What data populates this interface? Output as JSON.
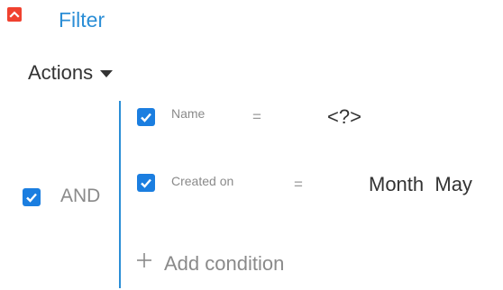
{
  "filter": {
    "title": "Filter",
    "collapse_icon": "chevron-up-icon",
    "accent_color": "#2b8ed6",
    "toggle_color": "#f0412f"
  },
  "actions": {
    "label": "Actions",
    "icon": "caret-down-icon"
  },
  "group": {
    "operator": "AND",
    "checked": true
  },
  "conditions": [
    {
      "field": "Name",
      "operator": "=",
      "value": "<?>",
      "checked": true
    },
    {
      "field": "Created on",
      "operator": "=",
      "value": "Month  May",
      "checked": true
    }
  ],
  "add_condition": {
    "label": "Add condition",
    "icon": "plus-icon"
  },
  "checkbox_color": "#1b7ee0"
}
